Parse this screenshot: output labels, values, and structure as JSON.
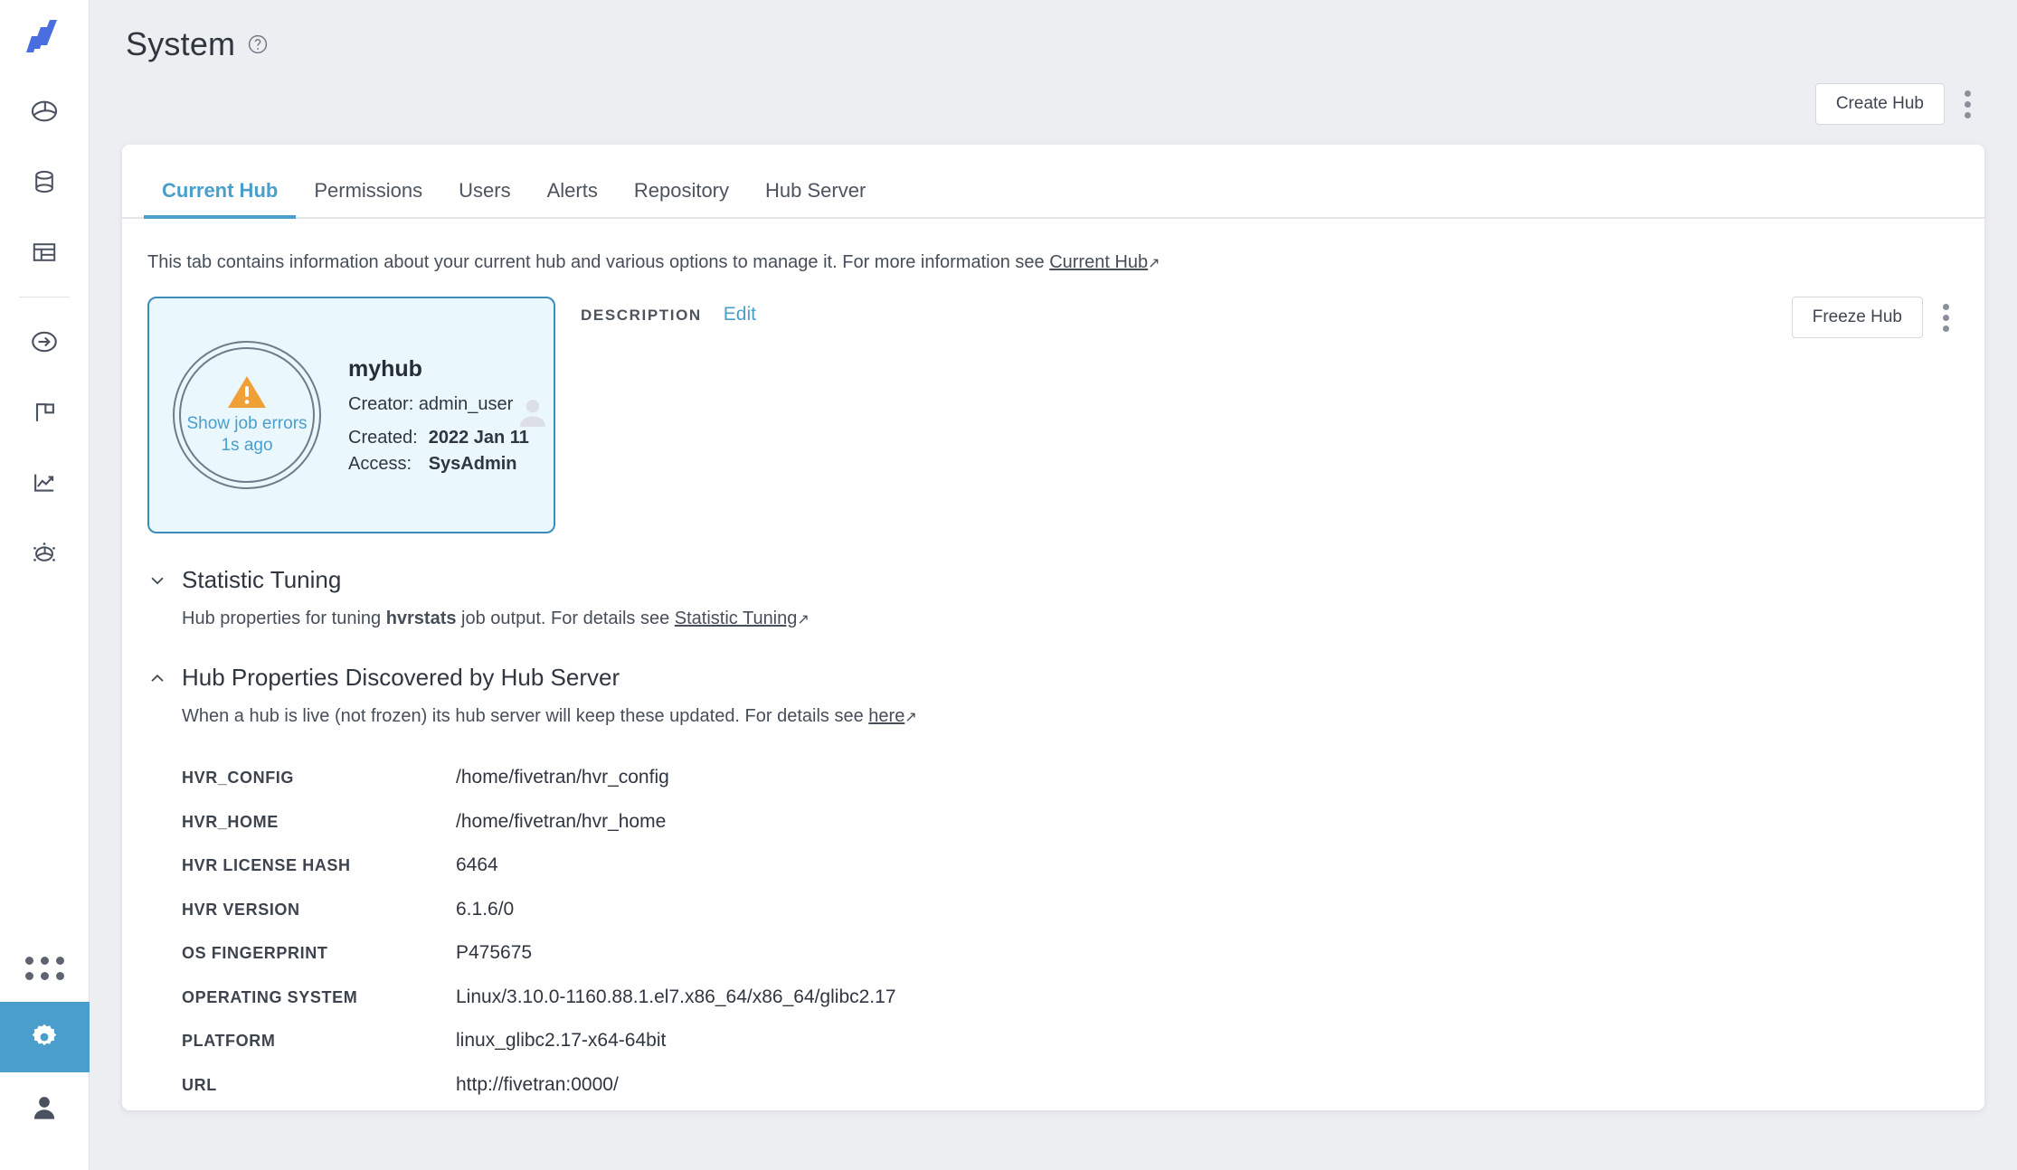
{
  "brand": {
    "logo_name": "fivetran-logo",
    "logo_color": "#4a6ee0",
    "accent_blue": "#4a9ecb",
    "page_bg": "#edeef2",
    "card_bg": "#eaf7fd",
    "card_border": "#3d8dba",
    "warning_orange": "#f0a035"
  },
  "sidebar": {
    "items": [
      {
        "name": "dashboard-icon",
        "label": "Dashboard"
      },
      {
        "name": "database-icon",
        "label": "Locations"
      },
      {
        "name": "table-icon",
        "label": "Channels"
      },
      {
        "name": "initialize-icon",
        "label": "Initialize"
      },
      {
        "name": "flag-icon",
        "label": "Events"
      },
      {
        "name": "statistics-icon",
        "label": "Statistics"
      },
      {
        "name": "insights-icon",
        "label": "Insights"
      }
    ],
    "bottom_items": [
      {
        "name": "apps-grid-icon",
        "label": "Apps"
      },
      {
        "name": "gear-icon",
        "label": "System",
        "active": true
      },
      {
        "name": "user-icon",
        "label": "Account"
      }
    ]
  },
  "header": {
    "title": "System",
    "help_icon": "help-circle-icon",
    "create_hub_label": "Create Hub",
    "overflow_icon": "kebab-menu-icon"
  },
  "tabs": [
    {
      "label": "Current Hub",
      "active": true
    },
    {
      "label": "Permissions",
      "active": false
    },
    {
      "label": "Users",
      "active": false
    },
    {
      "label": "Alerts",
      "active": false
    },
    {
      "label": "Repository",
      "active": false
    },
    {
      "label": "Hub Server",
      "active": false
    }
  ],
  "tab_description": {
    "text": "This tab contains information about your current hub and various options to manage it. For more information see ",
    "link": "Current Hub",
    "link_arrow": "↗"
  },
  "hub_card": {
    "status_icon": "warning-triangle-icon",
    "status_link": "Show job errors",
    "status_time": "1s ago",
    "name": "myhub",
    "creator_label": "Creator:",
    "creator_value": "admin_user",
    "avatar_icon": "user-avatar-icon",
    "created_label": "Created:",
    "created_value": "2022 Jan 11",
    "access_label": "Access:",
    "access_value": "SysAdmin"
  },
  "description_block": {
    "label": "DESCRIPTION",
    "edit_label": "Edit",
    "value": ""
  },
  "card_actions": {
    "freeze_hub_label": "Freeze Hub",
    "overflow_icon": "kebab-menu-icon"
  },
  "sections": [
    {
      "title": "Statistic Tuning",
      "expanded": false,
      "chevron": "chevron-down-icon",
      "desc_pre": "Hub properties for tuning ",
      "desc_bold": "hvrstats",
      "desc_post": " job output. For details see ",
      "link": "Statistic Tuning",
      "link_arrow": "↗"
    },
    {
      "title": "Hub Properties Discovered by Hub Server",
      "expanded": true,
      "chevron": "chevron-up-icon",
      "desc_pre": "When a hub is live (not frozen) its hub server will keep these updated. For details see ",
      "desc_bold": "",
      "desc_post": "",
      "link": "here",
      "link_arrow": "↗"
    }
  ],
  "properties": [
    {
      "key": "HVR_CONFIG",
      "value": "/home/fivetran/hvr_config"
    },
    {
      "key": "HVR_HOME",
      "value": "/home/fivetran/hvr_home"
    },
    {
      "key": "HVR LICENSE HASH",
      "value": "6464"
    },
    {
      "key": "HVR VERSION",
      "value": "6.1.6/0"
    },
    {
      "key": "OS FINGERPRINT",
      "value": "P475675"
    },
    {
      "key": "OPERATING SYSTEM",
      "value": "Linux/3.10.0-1160.88.1.el7.x86_64/x86_64/glibc2.17"
    },
    {
      "key": "PLATFORM",
      "value": "linux_glibc2.17-x64-64bit"
    },
    {
      "key": "URL",
      "value": "http://fivetran:0000/"
    }
  ]
}
